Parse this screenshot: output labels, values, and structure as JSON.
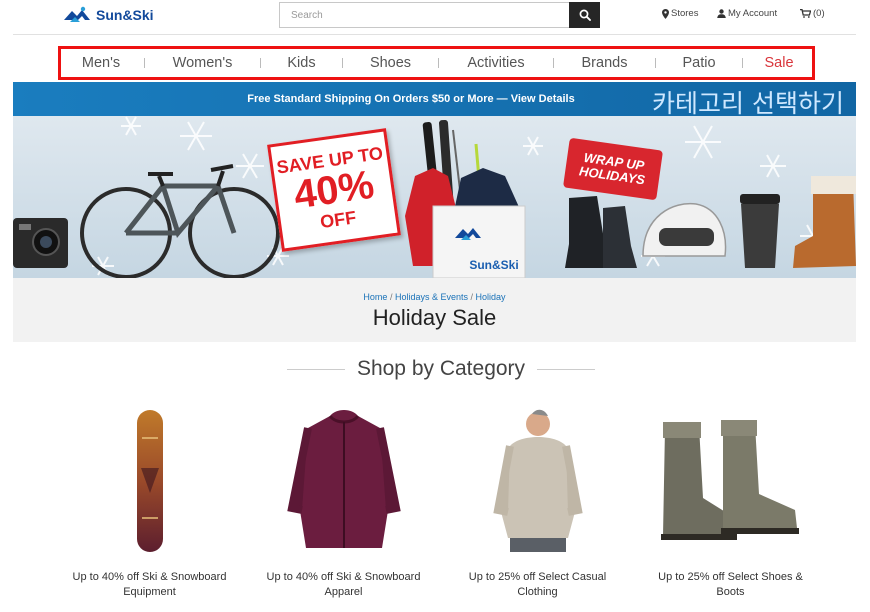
{
  "header": {
    "logo_text": "Sun&Ski",
    "search_placeholder": "Search",
    "stores_label": "Stores",
    "account_label": "My Account",
    "cart_label": "(0)"
  },
  "nav": {
    "items": [
      {
        "label": "Men's"
      },
      {
        "label": "Women's"
      },
      {
        "label": "Kids"
      },
      {
        "label": "Shoes"
      },
      {
        "label": "Activities"
      },
      {
        "label": "Brands"
      },
      {
        "label": "Patio"
      },
      {
        "label": "Sale"
      }
    ]
  },
  "shipping_banner": {
    "text": "Free Standard Shipping On Orders $50 or More — View Details",
    "annotation": "카테고리 선택하기"
  },
  "hero": {
    "save_line1": "SAVE UP TO",
    "save_line2": "40%",
    "save_line3": "OFF",
    "wrap_line1": "WRAP UP",
    "wrap_line2": "HOLIDAYS",
    "box_logo": "Sun&Ski"
  },
  "breadcrumb": {
    "items": [
      "Home",
      "Holidays & Events",
      "Holiday"
    ]
  },
  "page_title": "Holiday Sale",
  "category_section": {
    "heading": "Shop by Category",
    "cards": [
      {
        "label": "Up to 40% off Ski & Snowboard Equipment"
      },
      {
        "label": "Up to 40% off Ski & Snowboard Apparel"
      },
      {
        "label": "Up to 25% off Select Casual Clothing"
      },
      {
        "label": "Up to 25% off Select Shoes & Boots"
      }
    ]
  },
  "colors": {
    "brand_blue": "#12499b",
    "sale_red": "#d9353b",
    "highlight_red": "#ee1111",
    "banner_blue": "#1a7dbf"
  }
}
